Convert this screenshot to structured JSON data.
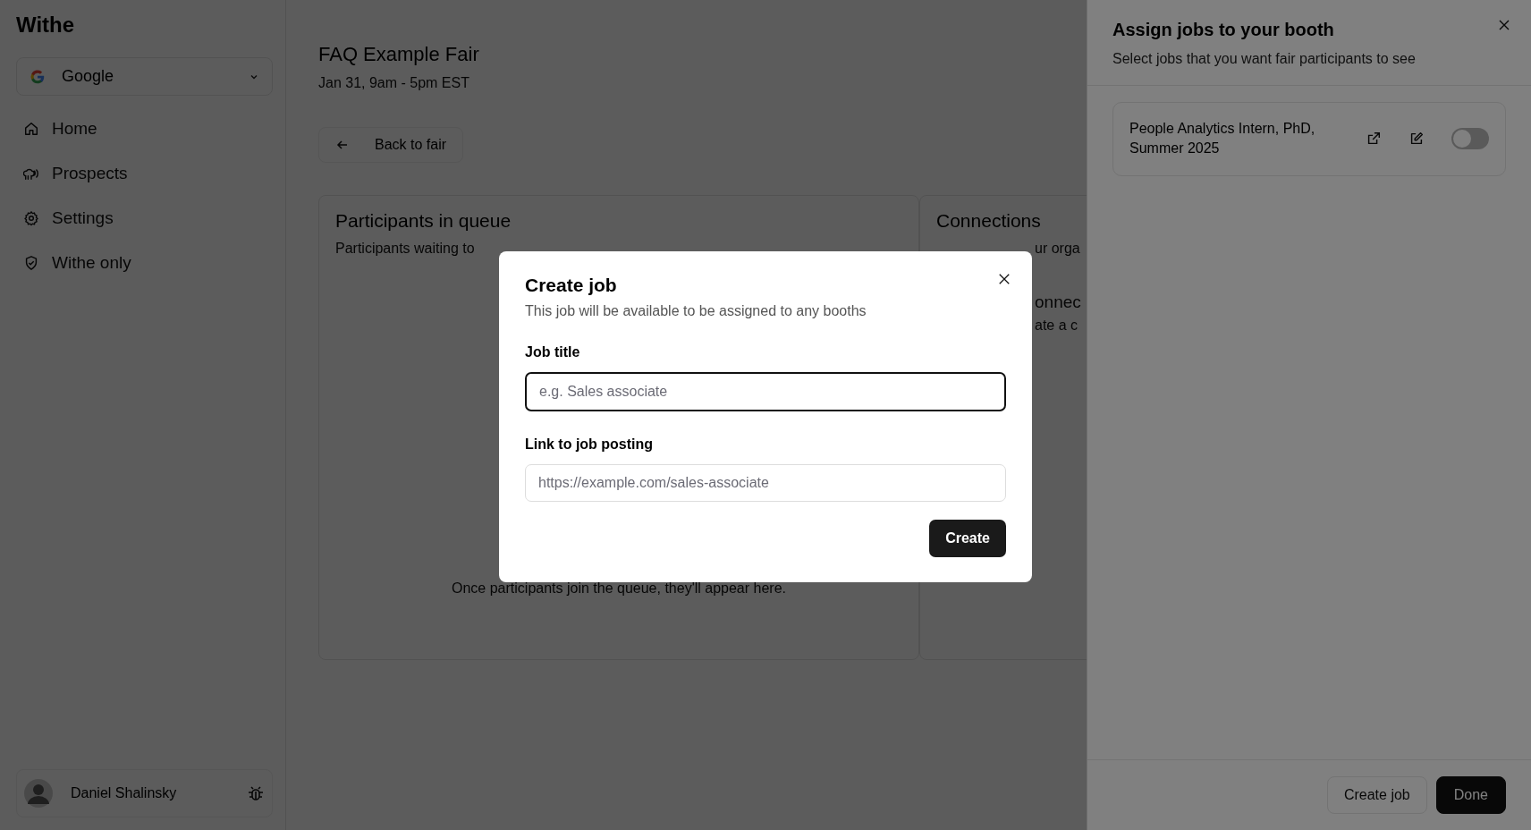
{
  "sidebar": {
    "logo": "Withe",
    "org": {
      "name": "Google"
    },
    "items": [
      {
        "kind": "home",
        "label": "Home"
      },
      {
        "kind": "prospects",
        "label": "Prospects"
      },
      {
        "kind": "settings",
        "label": "Settings"
      },
      {
        "kind": "shield",
        "label": "Withe only"
      }
    ],
    "user": {
      "name": "Daniel Shalinsky"
    }
  },
  "page": {
    "title": "FAQ Example Fair",
    "date": "Jan 31, 9am - 5pm EST",
    "back": "Back to fair",
    "queue": {
      "title": "Participants in queue",
      "subtitle": "Participants waiting to",
      "empty": "Once participants join the queue, they'll appear here."
    },
    "connections": {
      "title": "Connections",
      "subtitle": "ur orga",
      "line_2": "onnec",
      "line_3": "ate a c"
    }
  },
  "panel": {
    "title": "Assign jobs to your booth",
    "subtitle": "Select jobs that you want fair participants to see",
    "jobs": [
      {
        "title": "People Analytics Intern, PhD, Summer 2025",
        "on": false
      }
    ],
    "buttons": [
      {
        "kind": "secondary",
        "label": "Create job"
      },
      {
        "kind": "primary",
        "label": "Done"
      }
    ]
  },
  "dialog": {
    "title": "Create job",
    "subtitle": "This job will be available to be assigned to any booths",
    "fields": [
      {
        "label": "Job title",
        "placeholder": "e.g. Sales associate",
        "focused": true
      },
      {
        "label": "Link to job posting",
        "placeholder": "https://example.com/sales-associate",
        "focused": false
      }
    ],
    "submit": "Create"
  }
}
